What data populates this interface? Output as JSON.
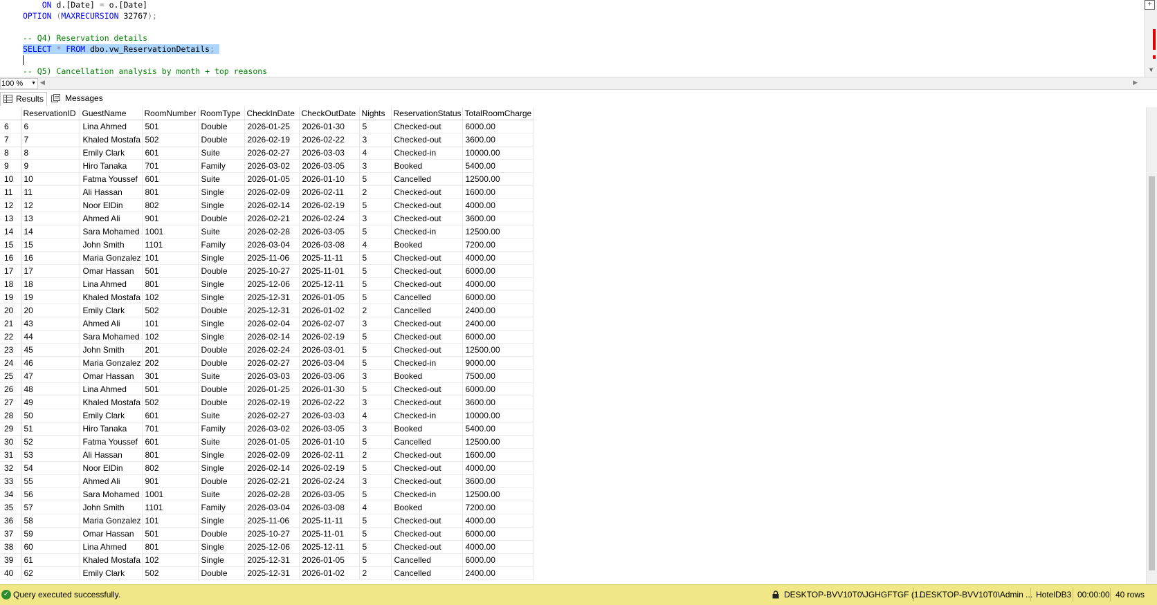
{
  "editor": {
    "lines": [
      {
        "parts": [
          {
            "c": "tx",
            "t": "    "
          },
          {
            "c": "kw",
            "t": "ON"
          },
          {
            "c": "tx",
            "t": " d.[Date] "
          },
          {
            "c": "gr",
            "t": "="
          },
          {
            "c": "tx",
            "t": " o.[Date]"
          }
        ]
      },
      {
        "parts": [
          {
            "c": "kw",
            "t": "OPTION"
          },
          {
            "c": "tx",
            "t": " "
          },
          {
            "c": "gr",
            "t": "("
          },
          {
            "c": "kw",
            "t": "MAXRECURSION"
          },
          {
            "c": "tx",
            "t": " 32767"
          },
          {
            "c": "gr",
            "t": ");"
          }
        ]
      },
      {
        "parts": []
      },
      {
        "parts": [
          {
            "c": "cm",
            "t": "-- Q4) Reservation details"
          }
        ]
      },
      {
        "parts": [
          {
            "c": "kw sel",
            "t": "SELECT"
          },
          {
            "c": "tx sel",
            "t": " "
          },
          {
            "c": "gr sel",
            "t": "*"
          },
          {
            "c": "tx sel",
            "t": " "
          },
          {
            "c": "kw sel",
            "t": "FROM"
          },
          {
            "c": "tx sel",
            "t": " dbo.vw_ReservationDetails"
          },
          {
            "c": "gr sel",
            "t": ";"
          },
          {
            "c": "tx sel",
            "t": " "
          }
        ]
      },
      {
        "parts": []
      },
      {
        "parts": [
          {
            "c": "cm",
            "t": "-- Q5) Cancellation analysis by month + top reasons"
          }
        ]
      }
    ],
    "scroll_icon": "split-window-icon"
  },
  "zoom": {
    "value": "100 %"
  },
  "tabs": [
    {
      "label": "Results",
      "icon": "grid-icon",
      "active": true
    },
    {
      "label": "Messages",
      "icon": "messages-icon",
      "active": false
    }
  ],
  "grid": {
    "columns": [
      "ReservationID",
      "GuestName",
      "RoomNumber",
      "RoomType",
      "CheckInDate",
      "CheckOutDate",
      "Nights",
      "ReservationStatus",
      "TotalRoomCharge"
    ],
    "rows": [
      [
        "6",
        "6",
        "Lina Ahmed",
        "501",
        "Double",
        "2026-01-25",
        "2026-01-30",
        "5",
        "Checked-out",
        "6000.00"
      ],
      [
        "7",
        "7",
        "Khaled Mostafa",
        "502",
        "Double",
        "2026-02-19",
        "2026-02-22",
        "3",
        "Checked-out",
        "3600.00"
      ],
      [
        "8",
        "8",
        "Emily Clark",
        "601",
        "Suite",
        "2026-02-27",
        "2026-03-03",
        "4",
        "Checked-in",
        "10000.00"
      ],
      [
        "9",
        "9",
        "Hiro Tanaka",
        "701",
        "Family",
        "2026-03-02",
        "2026-03-05",
        "3",
        "Booked",
        "5400.00"
      ],
      [
        "10",
        "10",
        "Fatma Youssef",
        "601",
        "Suite",
        "2026-01-05",
        "2026-01-10",
        "5",
        "Cancelled",
        "12500.00"
      ],
      [
        "11",
        "11",
        "Ali Hassan",
        "801",
        "Single",
        "2026-02-09",
        "2026-02-11",
        "2",
        "Checked-out",
        "1600.00"
      ],
      [
        "12",
        "12",
        "Noor ElDin",
        "802",
        "Single",
        "2026-02-14",
        "2026-02-19",
        "5",
        "Checked-out",
        "4000.00"
      ],
      [
        "13",
        "13",
        "Ahmed Ali",
        "901",
        "Double",
        "2026-02-21",
        "2026-02-24",
        "3",
        "Checked-out",
        "3600.00"
      ],
      [
        "14",
        "14",
        "Sara Mohamed",
        "1001",
        "Suite",
        "2026-02-28",
        "2026-03-05",
        "5",
        "Checked-in",
        "12500.00"
      ],
      [
        "15",
        "15",
        "John Smith",
        "1101",
        "Family",
        "2026-03-04",
        "2026-03-08",
        "4",
        "Booked",
        "7200.00"
      ],
      [
        "16",
        "16",
        "Maria Gonzalez",
        "101",
        "Single",
        "2025-11-06",
        "2025-11-11",
        "5",
        "Checked-out",
        "4000.00"
      ],
      [
        "17",
        "17",
        "Omar Hassan",
        "501",
        "Double",
        "2025-10-27",
        "2025-11-01",
        "5",
        "Checked-out",
        "6000.00"
      ],
      [
        "18",
        "18",
        "Lina Ahmed",
        "801",
        "Single",
        "2025-12-06",
        "2025-12-11",
        "5",
        "Checked-out",
        "4000.00"
      ],
      [
        "19",
        "19",
        "Khaled Mostafa",
        "102",
        "Single",
        "2025-12-31",
        "2026-01-05",
        "5",
        "Cancelled",
        "6000.00"
      ],
      [
        "20",
        "20",
        "Emily Clark",
        "502",
        "Double",
        "2025-12-31",
        "2026-01-02",
        "2",
        "Cancelled",
        "2400.00"
      ],
      [
        "21",
        "43",
        "Ahmed Ali",
        "101",
        "Single",
        "2026-02-04",
        "2026-02-07",
        "3",
        "Checked-out",
        "2400.00"
      ],
      [
        "22",
        "44",
        "Sara Mohamed",
        "102",
        "Single",
        "2026-02-14",
        "2026-02-19",
        "5",
        "Checked-out",
        "6000.00"
      ],
      [
        "23",
        "45",
        "John Smith",
        "201",
        "Double",
        "2026-02-24",
        "2026-03-01",
        "5",
        "Checked-out",
        "12500.00"
      ],
      [
        "24",
        "46",
        "Maria Gonzalez",
        "202",
        "Double",
        "2026-02-27",
        "2026-03-04",
        "5",
        "Checked-in",
        "9000.00"
      ],
      [
        "25",
        "47",
        "Omar Hassan",
        "301",
        "Suite",
        "2026-03-03",
        "2026-03-06",
        "3",
        "Booked",
        "7500.00"
      ],
      [
        "26",
        "48",
        "Lina Ahmed",
        "501",
        "Double",
        "2026-01-25",
        "2026-01-30",
        "5",
        "Checked-out",
        "6000.00"
      ],
      [
        "27",
        "49",
        "Khaled Mostafa",
        "502",
        "Double",
        "2026-02-19",
        "2026-02-22",
        "3",
        "Checked-out",
        "3600.00"
      ],
      [
        "28",
        "50",
        "Emily Clark",
        "601",
        "Suite",
        "2026-02-27",
        "2026-03-03",
        "4",
        "Checked-in",
        "10000.00"
      ],
      [
        "29",
        "51",
        "Hiro Tanaka",
        "701",
        "Family",
        "2026-03-02",
        "2026-03-05",
        "3",
        "Booked",
        "5400.00"
      ],
      [
        "30",
        "52",
        "Fatma Youssef",
        "601",
        "Suite",
        "2026-01-05",
        "2026-01-10",
        "5",
        "Cancelled",
        "12500.00"
      ],
      [
        "31",
        "53",
        "Ali Hassan",
        "801",
        "Single",
        "2026-02-09",
        "2026-02-11",
        "2",
        "Checked-out",
        "1600.00"
      ],
      [
        "32",
        "54",
        "Noor ElDin",
        "802",
        "Single",
        "2026-02-14",
        "2026-02-19",
        "5",
        "Checked-out",
        "4000.00"
      ],
      [
        "33",
        "55",
        "Ahmed Ali",
        "901",
        "Double",
        "2026-02-21",
        "2026-02-24",
        "3",
        "Checked-out",
        "3600.00"
      ],
      [
        "34",
        "56",
        "Sara Mohamed",
        "1001",
        "Suite",
        "2026-02-28",
        "2026-03-05",
        "5",
        "Checked-in",
        "12500.00"
      ],
      [
        "35",
        "57",
        "John Smith",
        "1101",
        "Family",
        "2026-03-04",
        "2026-03-08",
        "4",
        "Booked",
        "7200.00"
      ],
      [
        "36",
        "58",
        "Maria Gonzalez",
        "101",
        "Single",
        "2025-11-06",
        "2025-11-11",
        "5",
        "Checked-out",
        "4000.00"
      ],
      [
        "37",
        "59",
        "Omar Hassan",
        "501",
        "Double",
        "2025-10-27",
        "2025-11-01",
        "5",
        "Checked-out",
        "6000.00"
      ],
      [
        "38",
        "60",
        "Lina Ahmed",
        "801",
        "Single",
        "2025-12-06",
        "2025-12-11",
        "5",
        "Checked-out",
        "4000.00"
      ],
      [
        "39",
        "61",
        "Khaled Mostafa",
        "102",
        "Single",
        "2025-12-31",
        "2026-01-05",
        "5",
        "Cancelled",
        "6000.00"
      ],
      [
        "40",
        "62",
        "Emily Clark",
        "502",
        "Double",
        "2025-12-31",
        "2026-01-02",
        "2",
        "Cancelled",
        "2400.00"
      ]
    ]
  },
  "status": {
    "message": "Query executed successfully.",
    "server": "DESKTOP-BVV10T0\\JGHGFTGF (1...",
    "user": "DESKTOP-BVV10T0\\Admin ...",
    "database": "HotelDB3",
    "elapsed": "00:00:00",
    "row_count": "40 rows",
    "bar_color": "#f1e787",
    "success_color": "#2e8b2e"
  }
}
